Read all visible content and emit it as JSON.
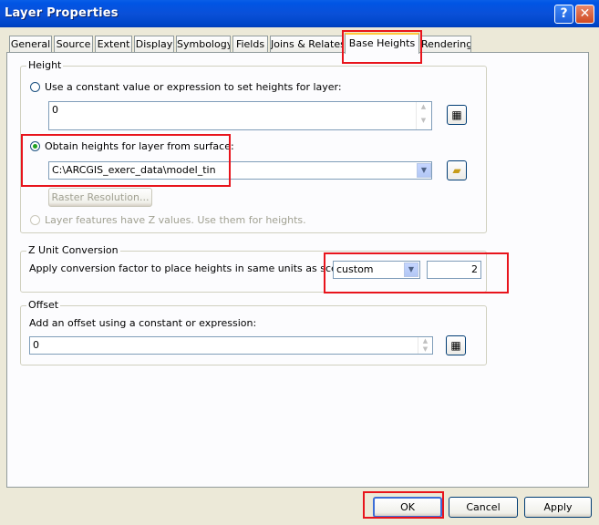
{
  "window": {
    "title": "Layer Properties",
    "help_label": "?",
    "close_label": "✕"
  },
  "tabs": [
    {
      "label": "General"
    },
    {
      "label": "Source"
    },
    {
      "label": "Extent"
    },
    {
      "label": "Display"
    },
    {
      "label": "Symbology"
    },
    {
      "label": "Fields"
    },
    {
      "label": "Joins & Relates"
    },
    {
      "label": "Base Heights"
    },
    {
      "label": "Rendering"
    }
  ],
  "height_group": {
    "legend": "Height",
    "constant_label": "Use a constant value or expression to set heights for layer:",
    "constant_value": "0",
    "surface_label": "Obtain heights for layer from surface:",
    "surface_value": "C:\\ARCGIS_exerc_data\\model_tin",
    "raster_button": "Raster Resolution...",
    "zvalues_label": "Layer features have Z values.  Use them for heights.",
    "selected_option": "surface"
  },
  "zunit_group": {
    "legend": "Z Unit Conversion",
    "label": "Apply conversion factor to place heights in same units as scene:",
    "unit_value": "custom",
    "factor_value": "2"
  },
  "offset_group": {
    "legend": "Offset",
    "label": "Add an offset using a constant or expression:",
    "value": "0"
  },
  "buttons": {
    "ok": "OK",
    "cancel": "Cancel",
    "apply": "Apply"
  },
  "icons": {
    "calculator": "calculator-icon",
    "folder": "open-folder-icon"
  },
  "colors": {
    "titlebar": "#0055e5",
    "highlight": "#e8141c",
    "active_tab": "#ffc83c"
  }
}
